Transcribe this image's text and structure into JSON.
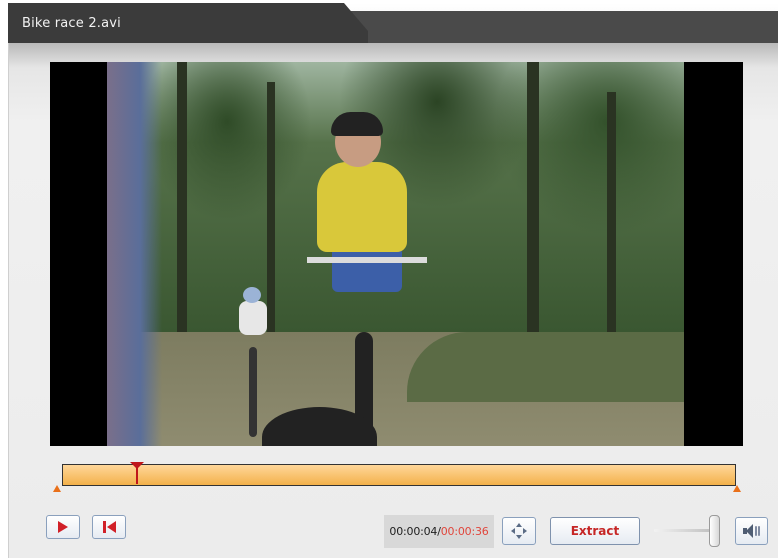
{
  "window": {
    "title": "Bike race 2.avi"
  },
  "timeline": {
    "position_seconds": 4,
    "duration_seconds": 36
  },
  "controls": {
    "time_current": "00:00:04",
    "time_separator": "/",
    "time_total": "00:00:36",
    "extract_label": "Extract"
  },
  "icons": {
    "play": "play-icon",
    "skip_to_start": "skip-to-start-icon",
    "fullscreen": "fullscreen-icon",
    "volume": "speaker-icon"
  },
  "colors": {
    "accent_red": "#c62626",
    "timeline_fill": "#f3b14b",
    "title_bar": "#3b3b3b"
  }
}
